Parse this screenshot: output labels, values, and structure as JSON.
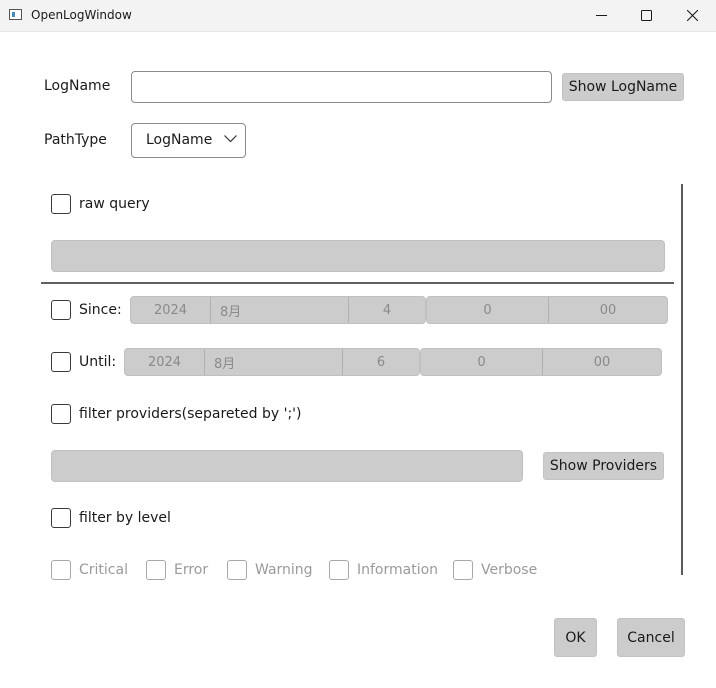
{
  "window": {
    "title": "OpenLogWindow",
    "controls": {
      "minimize": "minimize-icon",
      "maximize": "maximize-icon",
      "close": "close-icon"
    }
  },
  "logname": {
    "label": "LogName",
    "value": "",
    "button": "Show LogName"
  },
  "pathtype": {
    "label": "PathType",
    "selected": "LogName"
  },
  "raw_query": {
    "label": "raw query",
    "checked": false,
    "value": ""
  },
  "since": {
    "label": "Since:",
    "checked": false,
    "date": {
      "year": "2024",
      "month": "8月",
      "day": "4"
    },
    "time": {
      "hour": "0",
      "minute": "00"
    }
  },
  "until": {
    "label": "Until:",
    "checked": false,
    "date": {
      "year": "2024",
      "month": "8月",
      "day": "6"
    },
    "time": {
      "hour": "0",
      "minute": "00"
    }
  },
  "providers": {
    "label": "filter providers(separeted by ';')",
    "checked": false,
    "value": "",
    "button": "Show Providers"
  },
  "level": {
    "label": "filter by level",
    "checked": false,
    "options": [
      "Critical",
      "Error",
      "Warning",
      "Information",
      "Verbose"
    ]
  },
  "footer": {
    "ok": "OK",
    "cancel": "Cancel"
  }
}
